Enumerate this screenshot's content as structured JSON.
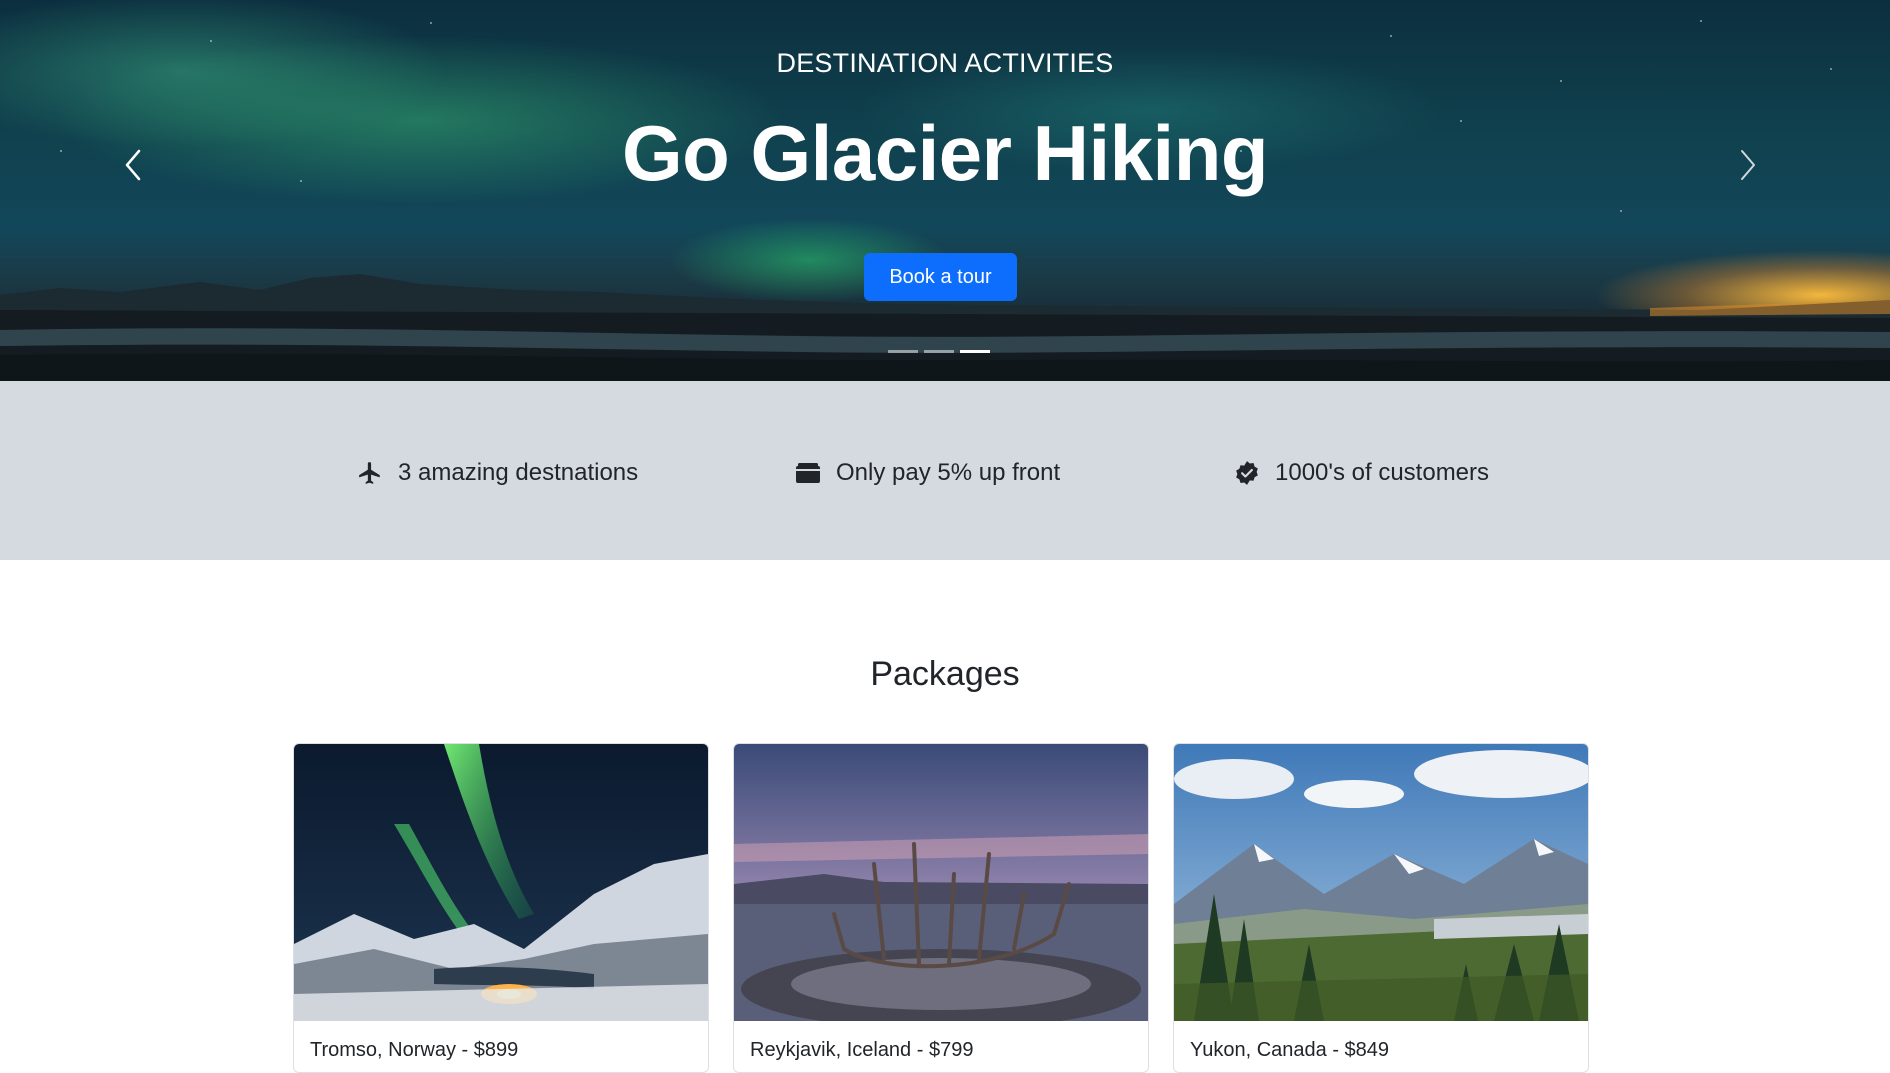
{
  "hero": {
    "eyebrow": "DESTINATION ACTIVITIES",
    "title": "Go Glacier Hiking",
    "cta_label": "Book a tour",
    "prev_icon": "chevron-left-icon",
    "next_icon": "chevron-right-icon",
    "slide_count": 3,
    "active_slide": 3
  },
  "features": [
    {
      "icon": "airplane-icon",
      "label": "3 amazing destnations"
    },
    {
      "icon": "wallet-icon",
      "label": "Only pay 5% up front"
    },
    {
      "icon": "verified-badge-icon",
      "label": "1000's of customers"
    }
  ],
  "packages": {
    "heading": "Packages",
    "items": [
      {
        "caption": "Tromso, Norway - $899",
        "image": "northern-lights-fjord"
      },
      {
        "caption": "Reykjavik, Iceland - $799",
        "image": "sun-voyager-sculpture"
      },
      {
        "caption": "Yukon, Canada - $849",
        "image": "mountain-valley-forest"
      }
    ]
  },
  "colors": {
    "primary": "#0d6efd",
    "band": "#d5dae1",
    "text": "#212529"
  }
}
